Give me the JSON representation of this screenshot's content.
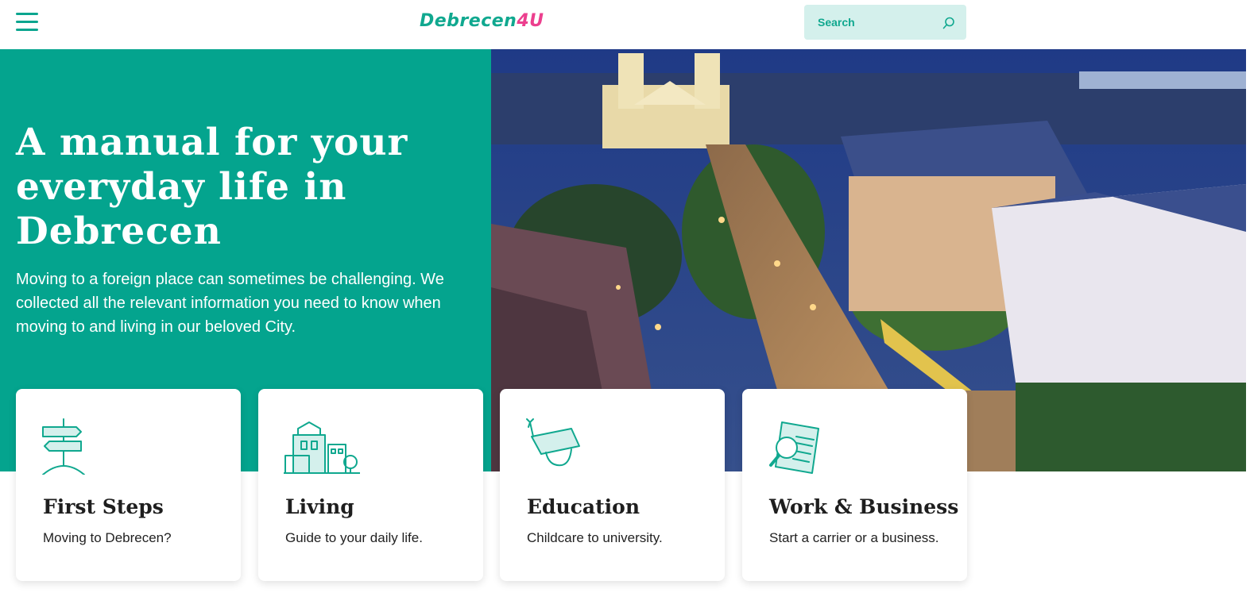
{
  "header": {
    "logo_part1": "Debrecen",
    "logo_part2": "4U",
    "search_placeholder": "Search",
    "menu_icon": "hamburger-menu-icon",
    "search_icon": "search-icon"
  },
  "hero": {
    "title": "A manual for your everyday life in Debrecen",
    "subtitle": "Moving to a foreign place can sometimes be challenging. We collected all the relevant information you need to know when moving to and living in our beloved City."
  },
  "cards": [
    {
      "title": "First Steps",
      "description": "Moving to Debrecen?",
      "icon": "signpost-icon"
    },
    {
      "title": "Living",
      "description": "Guide to your daily life.",
      "icon": "buildings-icon"
    },
    {
      "title": "Education",
      "description": "Childcare to university.",
      "icon": "graduation-cap-icon"
    },
    {
      "title": "Work & Business",
      "description": "Start a carrier or a business.",
      "icon": "document-magnifier-icon"
    }
  ],
  "colors": {
    "primary": "#04a48e",
    "accent": "#ec3f8e",
    "search_bg": "#d4f0ec"
  }
}
